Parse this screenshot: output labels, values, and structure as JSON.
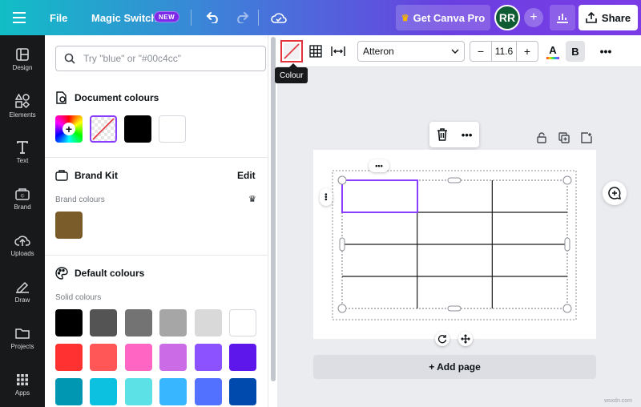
{
  "topbar": {
    "file_label": "File",
    "magic_switch_label": "Magic Switch",
    "new_badge": "NEW",
    "get_pro_label": "Get Canva Pro",
    "avatar_initials": "RR",
    "share_label": "Share"
  },
  "left_rail": {
    "items": [
      {
        "label": "Design",
        "icon": "layout-icon"
      },
      {
        "label": "Elements",
        "icon": "shapes-icon"
      },
      {
        "label": "Text",
        "icon": "text-icon"
      },
      {
        "label": "Brand",
        "icon": "brand-icon"
      },
      {
        "label": "Uploads",
        "icon": "cloud-upload-icon"
      },
      {
        "label": "Draw",
        "icon": "pen-icon"
      },
      {
        "label": "Projects",
        "icon": "folder-icon"
      },
      {
        "label": "Apps",
        "icon": "apps-icon"
      }
    ]
  },
  "colour_panel": {
    "search_placeholder": "Try \"blue\" or \"#00c4cc\"",
    "document_colours_title": "Document colours",
    "document_colours": [
      "#000000",
      "#ffffff"
    ],
    "brand_kit_title": "Brand Kit",
    "brand_edit_label": "Edit",
    "brand_colours_label": "Brand colours",
    "brand_colours": [
      "#7a5c2a"
    ],
    "default_colours_title": "Default colours",
    "solid_colours_label": "Solid colours",
    "solid_colours": [
      [
        "#000000",
        "#545454",
        "#737373",
        "#a6a6a6",
        "#d9d9d9",
        "#ffffff"
      ],
      [
        "#ff3131",
        "#ff5757",
        "#ff66c4",
        "#cb6ce6",
        "#8c52ff",
        "#5e17eb"
      ],
      [
        "#0097b2",
        "#0cc0df",
        "#5ce1e6",
        "#38b6ff",
        "#5271ff",
        "#004aad"
      ]
    ]
  },
  "context_toolbar": {
    "font_name": "Atteron",
    "font_size": "11.6",
    "minus": "−",
    "plus": "+",
    "text_color_glyph": "A",
    "bold_glyph": "B",
    "more_glyph": "•••"
  },
  "tooltip": {
    "label": "Colour"
  },
  "canvas": {
    "add_page_label": "+ Add page",
    "table_rows": 4,
    "table_cols": 3
  },
  "watermark": "wsxdn.com"
}
